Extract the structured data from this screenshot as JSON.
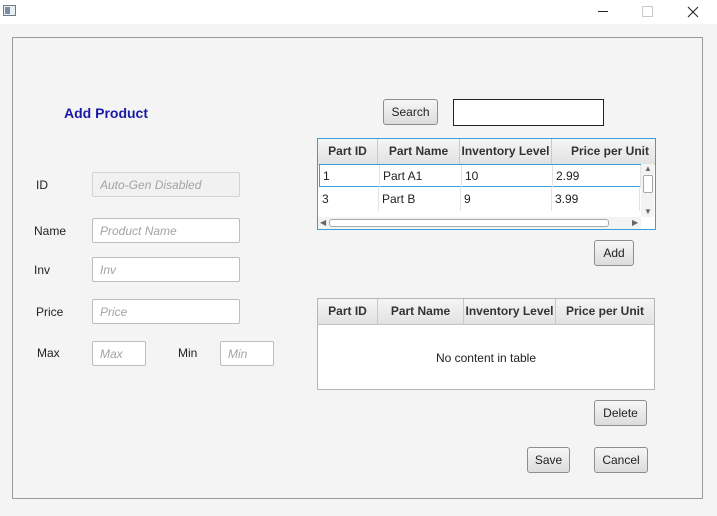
{
  "window": {
    "icons": {
      "app": "app-icon",
      "minimize": "minimize-icon",
      "maximize": "maximize-icon",
      "close": "close-icon"
    }
  },
  "form": {
    "heading": "Add Product",
    "id": {
      "label": "ID",
      "placeholder": "Auto-Gen Disabled",
      "value": ""
    },
    "name": {
      "label": "Name",
      "placeholder": "Product Name",
      "value": ""
    },
    "inv": {
      "label": "Inv",
      "placeholder": "Inv",
      "value": ""
    },
    "price": {
      "label": "Price",
      "placeholder": "Price",
      "value": ""
    },
    "max": {
      "label": "Max",
      "placeholder": "Max",
      "value": ""
    },
    "min": {
      "label": "Min",
      "placeholder": "Min",
      "value": ""
    }
  },
  "search": {
    "button_label": "Search",
    "value": ""
  },
  "parts_table": {
    "columns": [
      "Part ID",
      "Part Name",
      "Inventory Level",
      "Price per Unit"
    ],
    "rows": [
      {
        "id": "1",
        "name": "Part A1",
        "inventory": "10",
        "price": "2.99"
      },
      {
        "id": "3",
        "name": "Part B",
        "inventory": "9",
        "price": "3.99"
      }
    ]
  },
  "add_button": "Add",
  "associated_table": {
    "columns": [
      "Part ID",
      "Part Name",
      "Inventory Level",
      "Price per Unit"
    ],
    "empty_message": "No content in table"
  },
  "delete_button": "Delete",
  "save_button": "Save",
  "cancel_button": "Cancel",
  "colors": {
    "heading": "#1a1aa8",
    "selection_border": "#39a0d6"
  }
}
